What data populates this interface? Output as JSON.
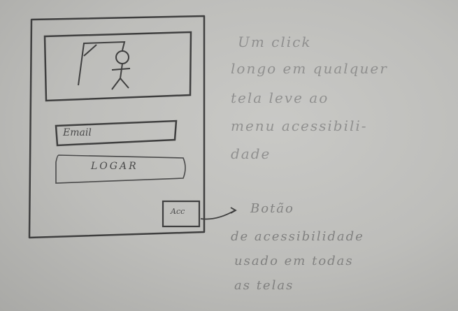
{
  "mockup": {
    "email_field": "Email",
    "login_button": "LOGAR",
    "accessibility_button": "Acc"
  },
  "notes": {
    "top_note": [
      "Um click",
      "longo em qualquer",
      "tela leve ao",
      "menu acessibili-",
      "dade"
    ],
    "arrow_note": [
      "Botão",
      "de acessibilidade",
      "usado em todas",
      "as telas"
    ]
  }
}
